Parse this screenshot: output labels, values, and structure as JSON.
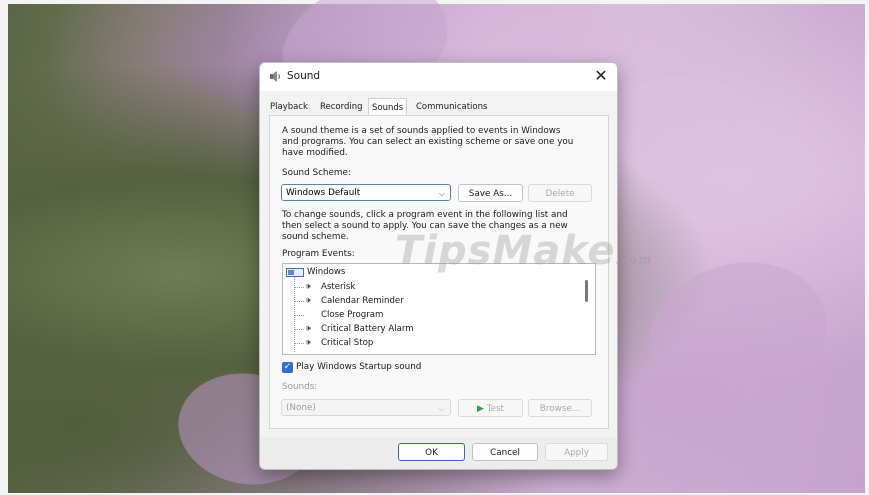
{
  "dialog": {
    "title": "Sound",
    "close_glyph": "✕"
  },
  "tabs": [
    {
      "label": "Playback",
      "active": false
    },
    {
      "label": "Recording",
      "active": false
    },
    {
      "label": "Sounds",
      "active": true
    },
    {
      "label": "Communications",
      "active": false
    }
  ],
  "sounds_tab": {
    "intro_lines": [
      "A sound theme is a set of sounds applied to events in Windows",
      "and programs.  You can select an existing scheme or save one you",
      "have modified."
    ],
    "scheme_label": "Sound Scheme:",
    "scheme_value": "Windows Default",
    "save_as_label": "Save As...",
    "delete_label": "Delete",
    "instructions_lines": [
      "To change sounds, click a program event in the following list and",
      "then select a sound to apply.  You can save the changes as a new",
      "sound scheme."
    ],
    "events_label": "Program Events:",
    "events": {
      "group": "Windows",
      "items": [
        {
          "label": "Asterisk",
          "icon": "speaker-icon"
        },
        {
          "label": "Calendar Reminder",
          "icon": "speaker-icon"
        },
        {
          "label": "Close Program",
          "icon": null
        },
        {
          "label": "Critical Battery Alarm",
          "icon": "speaker-icon"
        },
        {
          "label": "Critical Stop",
          "icon": "speaker-icon"
        }
      ]
    },
    "startup_checkbox_label": "Play Windows Startup sound",
    "startup_checked": true,
    "sounds_label": "Sounds:",
    "sounds_value": "(None)",
    "test_label": "Test",
    "browse_label": "Browse..."
  },
  "footer": {
    "ok_label": "OK",
    "cancel_label": "Cancel",
    "apply_label": "Apply"
  },
  "watermark": "TipsMake",
  "watermark_suffix": ".com",
  "colors": {
    "accent": "#2f6fd0",
    "test_play": "#2ea043"
  }
}
